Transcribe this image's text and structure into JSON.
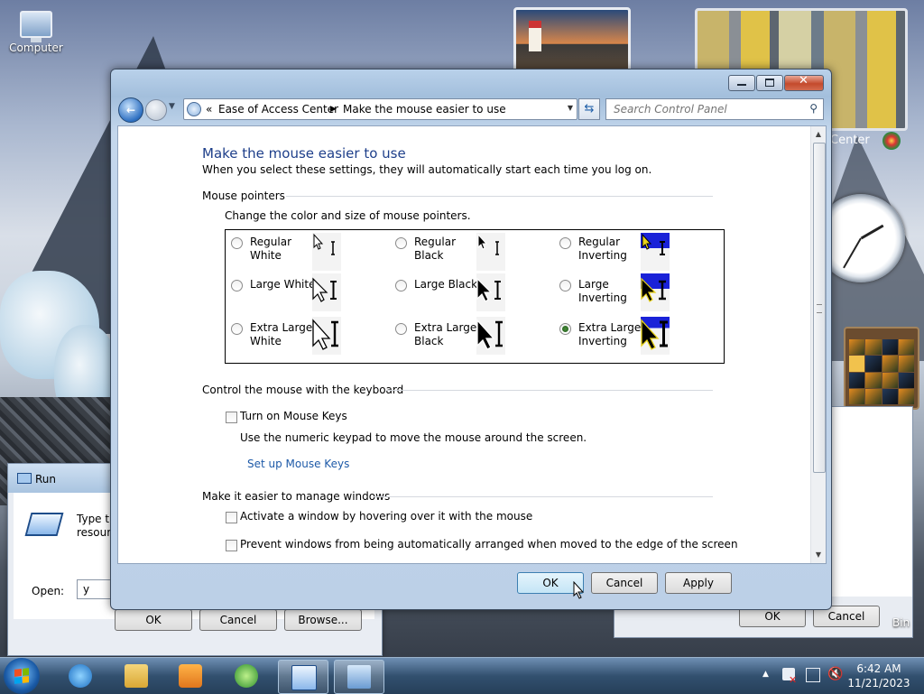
{
  "desktop": {
    "computer_label": "Computer",
    "recycle_partial": "Bin",
    "center_partial": "Center"
  },
  "window": {
    "address": {
      "prefix": "«",
      "crumb1": "Ease of Access Center",
      "sep": "▶",
      "crumb2": "Make the mouse easier to use"
    },
    "search_placeholder": "Search Control Panel",
    "title": "Make the mouse easier to use",
    "subtitle": "When you select these settings, they will automatically start each time you log on.",
    "mouse_pointers": {
      "heading": "Mouse pointers",
      "instruction": "Change the color and size of mouse pointers.",
      "options": [
        {
          "label": "Regular White",
          "selected": false
        },
        {
          "label": "Regular Black",
          "selected": false
        },
        {
          "label": "Regular Inverting",
          "selected": false
        },
        {
          "label": "Large White",
          "selected": false
        },
        {
          "label": "Large Black",
          "selected": false
        },
        {
          "label": "Large Inverting",
          "selected": false
        },
        {
          "label": "Extra Large White",
          "selected": false
        },
        {
          "label": "Extra Large Black",
          "selected": false
        },
        {
          "label": "Extra Large Inverting",
          "selected": true
        }
      ]
    },
    "keyboard": {
      "heading": "Control the mouse with the keyboard",
      "checkbox_label": "Turn on Mouse Keys",
      "checked": false,
      "description": "Use the numeric keypad to move the mouse around the screen.",
      "link": "Set up Mouse Keys"
    },
    "windows": {
      "heading": "Make it easier to manage windows",
      "activate_label": "Activate a window by hovering over it with the mouse",
      "prevent_label": "Prevent windows from being automatically arranged when moved to the edge of the screen"
    },
    "buttons": {
      "ok": "OK",
      "cancel": "Cancel",
      "apply": "Apply"
    }
  },
  "run_dialog": {
    "title": "Run",
    "prompt": "Type the resource",
    "open_label": "Open:",
    "open_value": "y",
    "ok": "OK",
    "cancel": "Cancel",
    "browse": "Browse..."
  },
  "bg_dialog": {
    "ok": "OK",
    "cancel": "Cancel"
  },
  "taskbar": {
    "time": "6:42 AM",
    "date": "11/21/2023",
    "tray_arrow": "▲"
  },
  "colors": {
    "heading_blue": "#1e3f8a",
    "link_blue": "#1e5aa8",
    "invert_blue": "#1a22d8"
  }
}
